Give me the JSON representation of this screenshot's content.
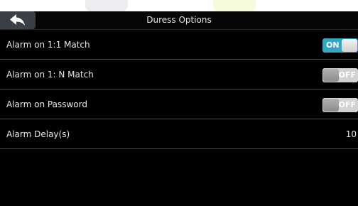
{
  "header": {
    "title": "Duress Options",
    "back_icon": "back-arrow-icon"
  },
  "settings": [
    {
      "label": "Alarm on 1:1 Match",
      "type": "toggle",
      "state_label": "ON",
      "on": true
    },
    {
      "label": "Alarm on 1: N Match",
      "type": "toggle",
      "state_label": "OFF",
      "on": false
    },
    {
      "label": "Alarm on Password",
      "type": "toggle",
      "state_label": "OFF",
      "on": false
    },
    {
      "label": "Alarm Delay(s)",
      "type": "value",
      "value": "10"
    }
  ],
  "colors": {
    "toggle_on": "#32a6c2",
    "toggle_off": "#d2d2d2",
    "background": "#000000"
  }
}
